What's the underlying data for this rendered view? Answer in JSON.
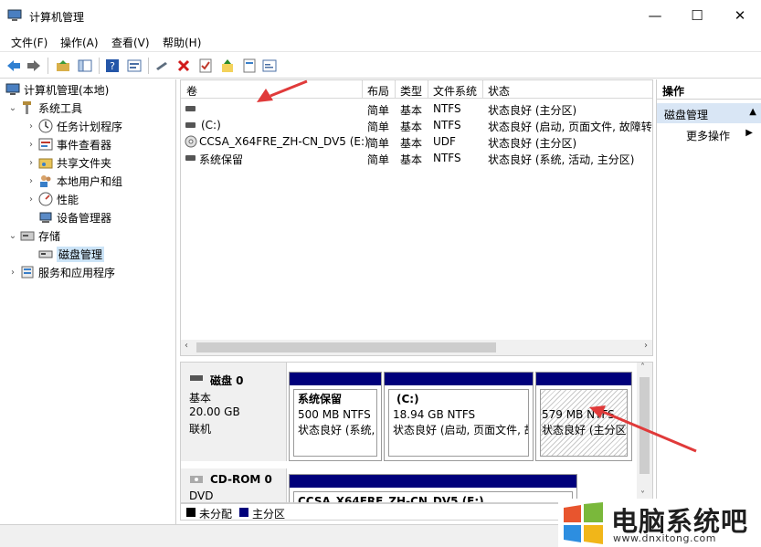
{
  "window": {
    "title": "计算机管理",
    "minimize": "—",
    "maximize": "☐",
    "close": "✕"
  },
  "menu": [
    "文件(F)",
    "操作(A)",
    "查看(V)",
    "帮助(H)"
  ],
  "toolbar_icons": [
    "back-arrow-icon",
    "forward-arrow-icon",
    "up-folder-icon",
    "show-hide-tree-icon",
    "help-icon",
    "console-icon",
    "connect-icon",
    "delete-icon",
    "properties-icon",
    "import-icon",
    "export-icon"
  ],
  "tree": {
    "root": "计算机管理(本地)",
    "system_tools": "系统工具",
    "task_scheduler": "任务计划程序",
    "event_viewer": "事件查看器",
    "shared_folders": "共享文件夹",
    "local_users": "本地用户和组",
    "performance": "性能",
    "device_manager": "设备管理器",
    "storage": "存储",
    "disk_management": "磁盘管理",
    "services_apps": "服务和应用程序"
  },
  "volumes": {
    "headers": [
      "卷",
      "布局",
      "类型",
      "文件系统",
      "状态"
    ],
    "rows": [
      {
        "name": "",
        "layout": "简单",
        "type": "基本",
        "fs": "NTFS",
        "status": "状态良好 (主分区)"
      },
      {
        "name": "(C:)",
        "layout": "简单",
        "type": "基本",
        "fs": "NTFS",
        "status": "状态良好 (启动, 页面文件, 故障转"
      },
      {
        "name": "CCSA_X64FRE_ZH-CN_DV5 (E:)",
        "layout": "简单",
        "type": "基本",
        "fs": "UDF",
        "status": "状态良好 (主分区)"
      },
      {
        "name": "系统保留",
        "layout": "简单",
        "type": "基本",
        "fs": "NTFS",
        "status": "状态良好 (系统, 活动, 主分区)"
      }
    ]
  },
  "disks": {
    "disk0": {
      "name": "磁盘 0",
      "kind": "基本",
      "size": "20.00 GB",
      "state": "联机",
      "partitions": [
        {
          "title": "系统保留",
          "size": "500 MB NTFS",
          "status": "状态良好 (系统, )"
        },
        {
          "title": "(C:)",
          "size": "18.94 GB NTFS",
          "status": "状态良好 (启动, 页面文件, 故"
        },
        {
          "title": "",
          "size": "579 MB NTFS",
          "status": "状态良好 (主分区"
        }
      ]
    },
    "cdrom0": {
      "name": "CD-ROM 0",
      "kind": "DVD",
      "partition_title": "CCSA_X64FRE_ZH-CN_DV5  (E:)"
    }
  },
  "legend": {
    "unallocated": "未分配",
    "primary": "主分区",
    "unallocated_color": "#000000",
    "primary_color": "#00007b"
  },
  "actions": {
    "header": "操作",
    "selected": "磁盘管理",
    "more": "更多操作"
  },
  "watermark": {
    "brand": "电脑系统吧",
    "url": "www.dnxitong.com"
  },
  "colors": {
    "annotation_arrow": "#e03a3a",
    "selection": "#cce4f7"
  }
}
